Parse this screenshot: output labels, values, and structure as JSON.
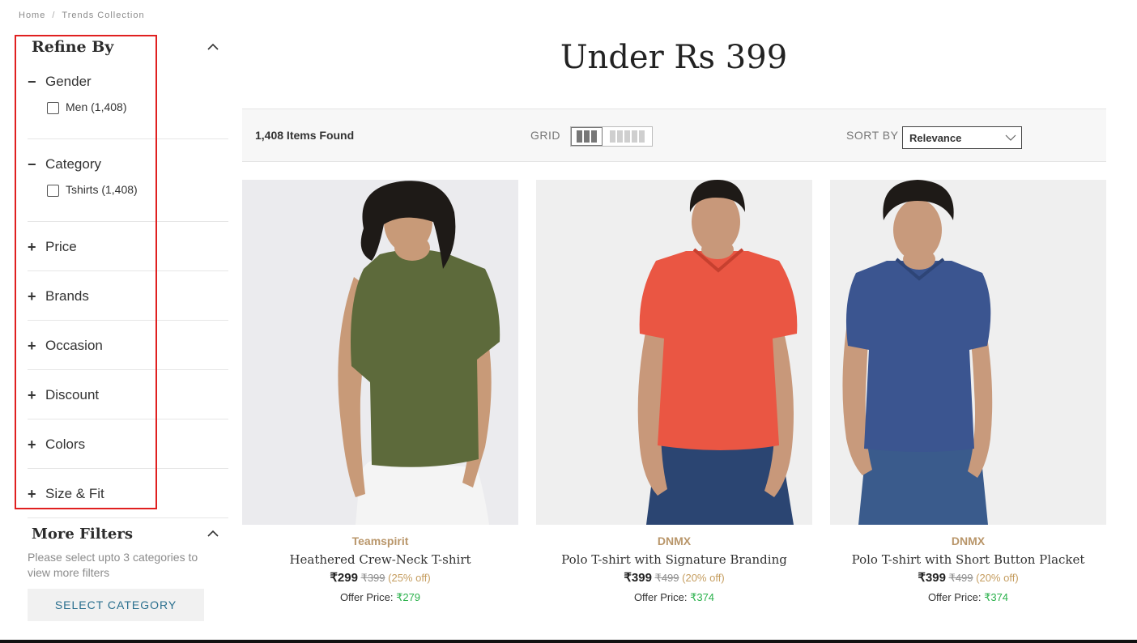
{
  "breadcrumb": {
    "home": "Home",
    "separator": "/",
    "current": "Trends Collection"
  },
  "sidebar": {
    "title": "Refine By",
    "facets": [
      {
        "label": "Gender",
        "sign": "−",
        "options": [
          {
            "label": "Men (1,408)"
          }
        ]
      },
      {
        "label": "Category",
        "sign": "−",
        "options": [
          {
            "label": "Tshirts (1,408)"
          }
        ]
      },
      {
        "label": "Price",
        "sign": "+"
      },
      {
        "label": "Brands",
        "sign": "+"
      },
      {
        "label": "Occasion",
        "sign": "+"
      },
      {
        "label": "Discount",
        "sign": "+"
      },
      {
        "label": "Colors",
        "sign": "+"
      },
      {
        "label": "Size & Fit",
        "sign": "+"
      }
    ],
    "more_filters": {
      "title": "More Filters",
      "hint": "Please select upto 3 categories to view more filters",
      "button": "SELECT CATEGORY"
    }
  },
  "main": {
    "title": "Under Rs 399",
    "toolbar": {
      "items_found": "1,408 Items Found",
      "grid_label": "GRID",
      "sort_label": "SORT BY",
      "sort_value": "Relevance"
    },
    "products": [
      {
        "brand": "Teamspirit",
        "name": "Heathered Crew-Neck T-shirt",
        "price": "₹299",
        "mrp": "₹399",
        "discount": "(25% off)",
        "offer_label": "Offer Price:",
        "offer_price": "₹279",
        "image": {
          "shirt_color": "#5d6a3b",
          "skin_color": "#c89a78",
          "hair_color": "#1e1a17",
          "pants_color": "#f4f4f4"
        }
      },
      {
        "brand": "DNMX",
        "name": "Polo T-shirt with Signature Branding",
        "price": "₹399",
        "mrp": "₹499",
        "discount": "(20% off)",
        "offer_label": "Offer Price:",
        "offer_price": "₹374",
        "image": {
          "shirt_color": "#ea5643",
          "skin_color": "#c8987a",
          "hair_color": "#1e1a17",
          "pants_color": "#2b4572"
        }
      },
      {
        "brand": "DNMX",
        "name": "Polo T-shirt with Short Button Placket",
        "price": "₹399",
        "mrp": "₹499",
        "discount": "(20% off)",
        "offer_label": "Offer Price:",
        "offer_price": "₹374",
        "image": {
          "shirt_color": "#3b5590",
          "skin_color": "#c89a7c",
          "hair_color": "#1e1a17",
          "pants_color": "#3a5b8c"
        }
      }
    ]
  }
}
